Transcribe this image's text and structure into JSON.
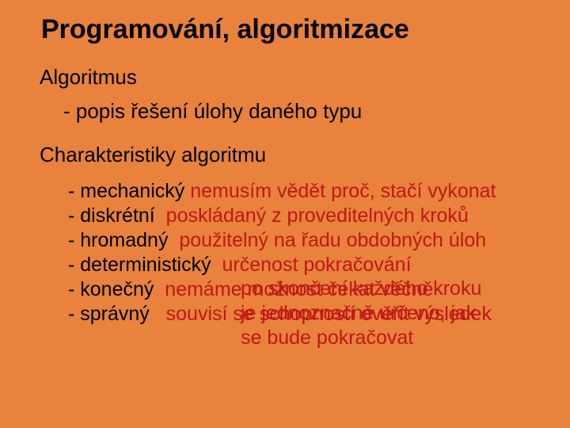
{
  "title": "Programování, algoritmizace",
  "section1": "Algoritmus",
  "sub1": "- popis řešení úlohy daného typu",
  "section2": "Charakteristiky algoritmu",
  "items": [
    {
      "label": "- mechanický",
      "desc": "nemusím vědět proč, stačí vykonat"
    },
    {
      "label": "- diskrétní",
      "desc": "poskládaný z proveditelných kroků"
    },
    {
      "label": "- hromadný",
      "desc": "použitelný na řadu obdobných úloh"
    },
    {
      "label": "- deterministický",
      "desc": "určenost pokračování"
    },
    {
      "label": "- konečný",
      "desc": "nemáme možnost čekat věčně"
    },
    {
      "label": "- správný",
      "desc": "souvisí se schopností ověřit výsledek"
    }
  ],
  "overlay": {
    "line1": "po skončení každého kroku",
    "line2": "je jednoznačně určeno, jak",
    "line3": "se bude  pokračovat"
  }
}
